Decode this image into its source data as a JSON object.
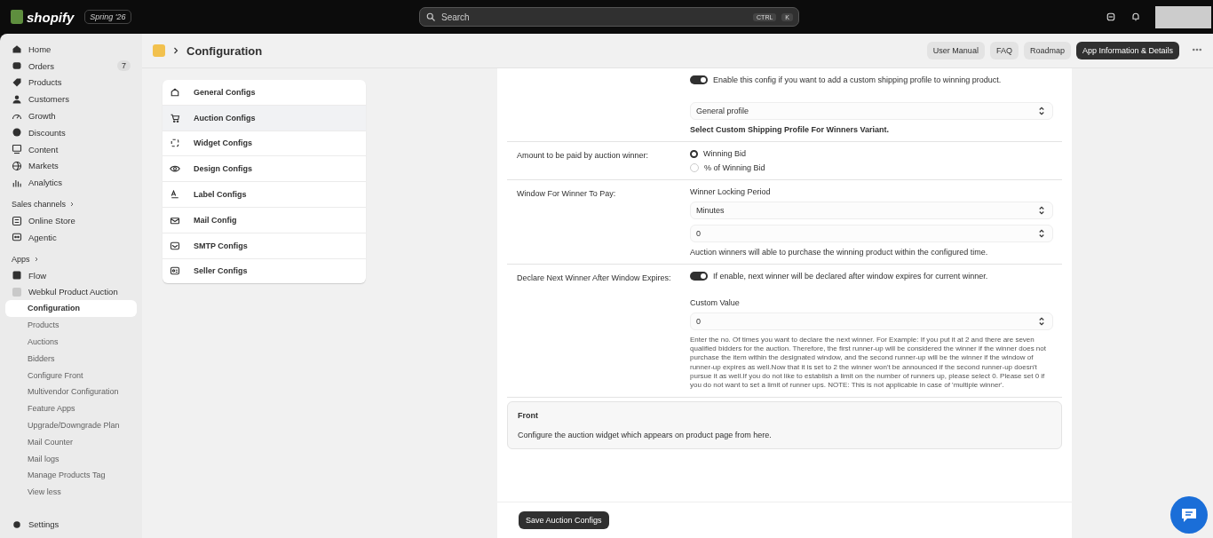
{
  "topbar": {
    "logo": "shopify",
    "edition": "Spring '26",
    "search": {
      "placeholder": "Search",
      "keys": [
        "CTRL",
        "K"
      ]
    }
  },
  "sidebar": {
    "main": [
      {
        "label": "Home"
      },
      {
        "label": "Orders",
        "badge": "7"
      },
      {
        "label": "Products"
      },
      {
        "label": "Customers"
      },
      {
        "label": "Growth"
      },
      {
        "label": "Discounts"
      },
      {
        "label": "Content"
      },
      {
        "label": "Markets"
      },
      {
        "label": "Analytics"
      }
    ],
    "sales_channels": {
      "title": "Sales channels",
      "items": [
        {
          "label": "Online Store"
        },
        {
          "label": "Agentic"
        }
      ]
    },
    "apps": {
      "title": "Apps",
      "items": [
        {
          "label": "Flow"
        },
        {
          "label": "Webkul Product Auction",
          "children": [
            {
              "label": "Configuration",
              "selected": true
            },
            {
              "label": "Products",
              "selected": false
            },
            {
              "label": "Auctions",
              "selected": false
            },
            {
              "label": "Bidders",
              "selected": false
            },
            {
              "label": "Configure Front",
              "selected": false
            },
            {
              "label": "Multivendor Configuration",
              "selected": false
            },
            {
              "label": "Feature Apps",
              "selected": false
            },
            {
              "label": "Upgrade/Downgrade Plan",
              "selected": false
            },
            {
              "label": "Mail Counter",
              "selected": false
            },
            {
              "label": "Mail logs",
              "selected": false
            },
            {
              "label": "Manage Products Tag",
              "selected": false
            }
          ]
        }
      ],
      "toggle": "View less"
    },
    "settings": "Settings"
  },
  "page": {
    "title": "Configuration",
    "actions": [
      {
        "label": "User Manual",
        "primary": false
      },
      {
        "label": "FAQ",
        "primary": false
      },
      {
        "label": "Roadmap",
        "primary": false
      },
      {
        "label": "App Information & Details",
        "primary": true
      }
    ]
  },
  "config_menu": [
    {
      "label": "General Configs",
      "selected": false
    },
    {
      "label": "Auction Configs",
      "selected": true
    },
    {
      "label": "Widget Configs",
      "selected": false
    },
    {
      "label": "Design Configs",
      "selected": false
    },
    {
      "label": "Label Configs",
      "selected": false
    },
    {
      "label": "Mail Config",
      "selected": false
    },
    {
      "label": "SMTP Configs",
      "selected": false
    },
    {
      "label": "Seller Configs",
      "selected": false
    }
  ],
  "form": {
    "rows": [
      {
        "toggle": {
          "on": true,
          "text": "Enable this config if you want to add a custom shipping profile to winning product."
        },
        "select": "General profile",
        "help": "Select Custom Shipping Profile For Winners Variant.",
        "help_bold": true
      },
      {
        "label": "Amount to be paid by auction winner:",
        "radios": [
          {
            "label": "Winning Bid",
            "selected": true
          },
          {
            "label": "% of Winning Bid",
            "selected": false
          }
        ]
      },
      {
        "label": "Window For Winner To Pay:",
        "field_label": "Winner Locking Period",
        "select": "Minutes",
        "number": "0",
        "help": "Auction winners will able to purchase the winning product within the configured time.",
        "help_bold": false
      },
      {
        "label": "Declare Next Winner After Window Expires:",
        "toggle": {
          "on": true,
          "text": "If enable, next winner will be declared after window expires for current winner."
        },
        "field_label": "Custom Value",
        "number": "0",
        "note": "Enter the no. Of times you want to declare the next winner. For Example: If you put it at 2 and there are seven qualified bidders for the auction. Therefore, the first runner-up will be considered the winner if the winner does not purchase the item within the designated window, and the second runner-up will be the winner if the window of runner-up expires as well.Now that it is set to 2 the winner won't be announced if the second runner-up doesn't pursue it as well.If you do not like to establish a limit on the number of runners up, please select 0. Please set 0 if you do not want to set a limit of runner ups. NOTE: This is not applicable in case of 'multiple winner'."
      }
    ],
    "section": {
      "title": "Front",
      "description": "Configure the auction widget which appears on product page from here."
    },
    "save": "Save Auction Configs"
  }
}
